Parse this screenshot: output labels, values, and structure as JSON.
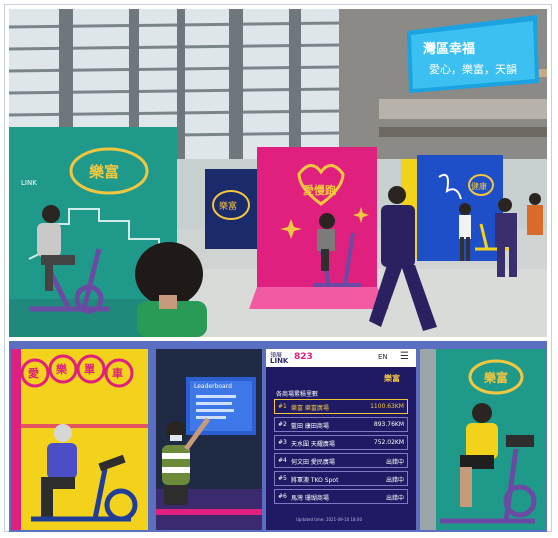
{
  "main_scene": {
    "banner": {
      "line1": "灣區幸福",
      "line2": "愛心，樂富，天韻"
    },
    "booths": {
      "teal_logo": "樂富",
      "teal_sub": "LINK",
      "pink_logo": "愛慢跑",
      "navy_logo": "樂富",
      "blue_logo": "健康"
    }
  },
  "panels": {
    "yellow": {
      "circles": [
        "愛",
        "樂",
        "單",
        "車"
      ]
    },
    "screen": {
      "title": "Leaderboard"
    },
    "phone": {
      "brand_line1": "領展",
      "brand_line2": "LINK",
      "brand_badge": "823",
      "lang": "EN",
      "corner_logo": "樂富",
      "heading": "各商場累積里數",
      "rows": [
        {
          "rank": "#1",
          "name": "樂富 樂富廣場",
          "value": "1100.63KM"
        },
        {
          "rank": "#2",
          "name": "藍田 康田商場",
          "value": "893.76KM"
        },
        {
          "rank": "#3",
          "name": "天水圍 天耀廣場",
          "value": "752.02KM"
        },
        {
          "rank": "#4",
          "name": "何文田 愛民廣場",
          "value": "出錯中"
        },
        {
          "rank": "#5",
          "name": "將軍澳 TKO Spot",
          "value": "出錯中"
        },
        {
          "rank": "#6",
          "name": "馬灣 珊瑚商場",
          "value": "出錯中"
        }
      ],
      "footer": "Updated time: 2021-09-10 18:00"
    },
    "green": {
      "logo": "樂富"
    }
  },
  "colors": {
    "strip_bg": "#5b6fc2",
    "teal_booth": "#1f9a8a",
    "pink_booth": "#e0207e",
    "navy_booth": "#1b2a6b",
    "blue_booth": "#1e4fc9",
    "yellow_panel": "#f2d21a",
    "phone_bg": "#1f1a63",
    "gold": "#f3c640"
  }
}
